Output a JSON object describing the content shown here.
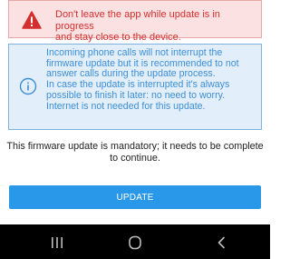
{
  "warning": {
    "icon": "warning-triangle-icon",
    "color": "#d32f2f",
    "lines": [
      "Don't leave the app while update is in progress",
      "and stay close to the device."
    ]
  },
  "info": {
    "icon": "info-circle-icon",
    "color": "#3d8fd6",
    "lines": [
      "Incoming phone calls will not interrupt the",
      "firmware update but it is recommended to not",
      "answer calls during the update process.",
      "In case the update is interrupted it's always",
      "possible to finish it later: no need to worry.",
      "Internet is not needed for this update."
    ]
  },
  "mandatory": {
    "lines": [
      "This firmware update is mandatory; it needs to be complete",
      "to continue."
    ]
  },
  "update_button": {
    "label": "UPDATE",
    "color": "#2a98e8"
  },
  "nav": {
    "recents_icon": "recents-icon",
    "home_icon": "home-icon",
    "back_icon": "back-icon"
  }
}
